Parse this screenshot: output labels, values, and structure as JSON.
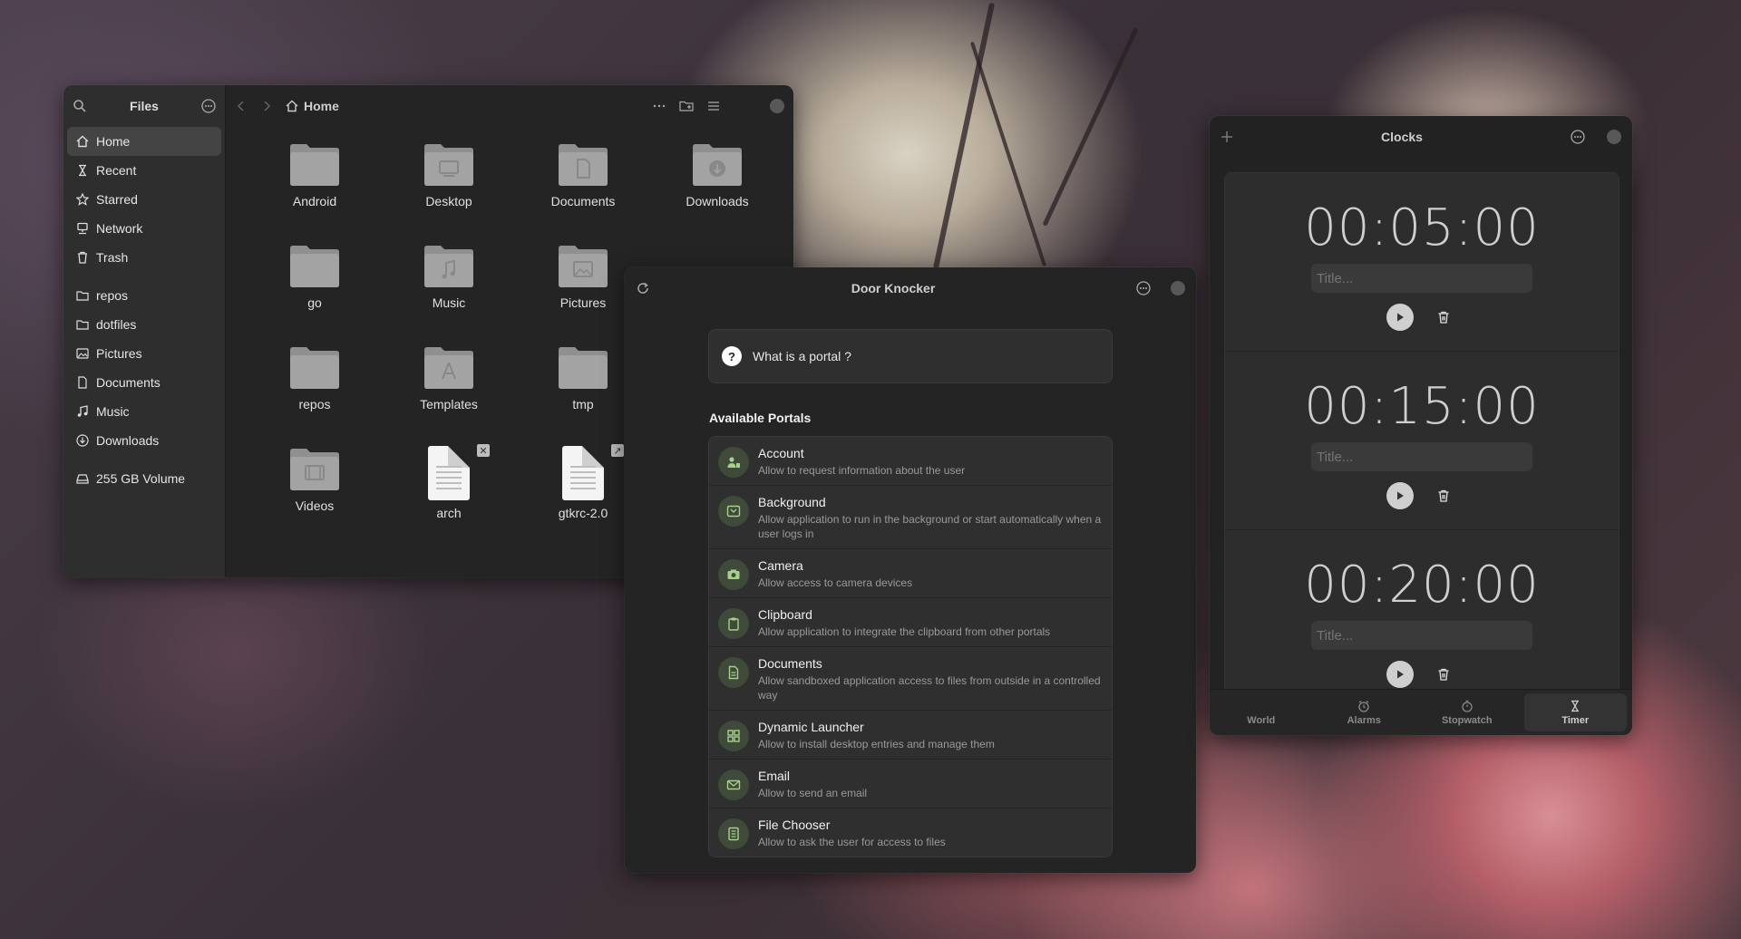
{
  "files": {
    "sidebar_title": "Files",
    "path": "Home",
    "places": [
      {
        "label": "Home",
        "icon": "home-icon"
      },
      {
        "label": "Recent",
        "icon": "clock-icon"
      },
      {
        "label": "Starred",
        "icon": "star-icon"
      },
      {
        "label": "Network",
        "icon": "network-icon"
      },
      {
        "label": "Trash",
        "icon": "trash-icon"
      }
    ],
    "bookmarks": [
      {
        "label": "repos",
        "icon": "folder-icon"
      },
      {
        "label": "dotfiles",
        "icon": "folder-icon"
      },
      {
        "label": "Pictures",
        "icon": "image-icon"
      },
      {
        "label": "Documents",
        "icon": "document-icon"
      },
      {
        "label": "Music",
        "icon": "music-icon"
      },
      {
        "label": "Downloads",
        "icon": "download-icon"
      }
    ],
    "devices": [
      {
        "label": "255 GB Volume",
        "icon": "drive-icon"
      }
    ],
    "items": [
      {
        "label": "Android",
        "type": "folder"
      },
      {
        "label": "Desktop",
        "type": "folder"
      },
      {
        "label": "Documents",
        "type": "folder"
      },
      {
        "label": "Downloads",
        "type": "folder"
      },
      {
        "label": "go",
        "type": "folder"
      },
      {
        "label": "Music",
        "type": "folder"
      },
      {
        "label": "Pictures",
        "type": "folder"
      },
      {
        "label": "repos",
        "type": "folder"
      },
      {
        "label": "Templates",
        "type": "folder"
      },
      {
        "label": "tmp",
        "type": "folder"
      },
      {
        "label": "Videos",
        "type": "folder"
      },
      {
        "label": "arch",
        "type": "file"
      },
      {
        "label": "gtkrc-2.0",
        "type": "file"
      }
    ]
  },
  "door_knocker": {
    "title": "Door Knocker",
    "question": "What is a portal ?",
    "section_title": "Available Portals",
    "portals": [
      {
        "name": "Account",
        "desc": "Allow to request information about the user"
      },
      {
        "name": "Background",
        "desc": "Allow application to run in the background or start automatically when a user logs in"
      },
      {
        "name": "Camera",
        "desc": "Allow access to camera devices"
      },
      {
        "name": "Clipboard",
        "desc": "Allow application to integrate the clipboard from other portals"
      },
      {
        "name": "Documents",
        "desc": "Allow sandboxed application access to files from outside in a controlled way"
      },
      {
        "name": "Dynamic Launcher",
        "desc": "Allow to install desktop entries and manage them"
      },
      {
        "name": "Email",
        "desc": "Allow to send an email"
      },
      {
        "name": "File Chooser",
        "desc": "Allow to ask the user for access to files"
      }
    ]
  },
  "clocks": {
    "title": "Clocks",
    "timers": [
      {
        "value": "00:05:00",
        "placeholder": "Title..."
      },
      {
        "value": "00:15:00",
        "placeholder": "Title..."
      },
      {
        "value": "00:20:00",
        "placeholder": "Title..."
      }
    ],
    "tabs": [
      {
        "label": "World",
        "icon": "globe-icon"
      },
      {
        "label": "Alarms",
        "icon": "alarm-icon"
      },
      {
        "label": "Stopwatch",
        "icon": "stopwatch-icon"
      },
      {
        "label": "Timer",
        "icon": "hourglass-icon"
      }
    ],
    "active_tab": "Timer"
  },
  "colors": {
    "accent_green": "#a8d08d",
    "window_bg": "#242424"
  }
}
